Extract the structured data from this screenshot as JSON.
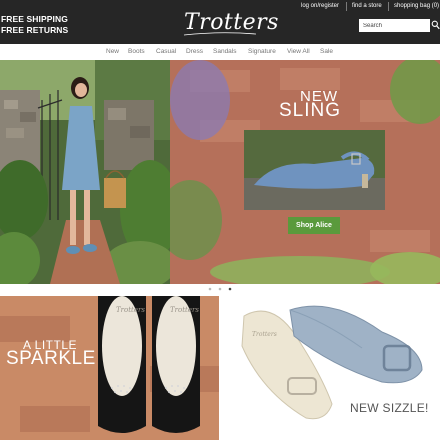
{
  "header": {
    "promo_line1": "FREE SHIPPING",
    "promo_line2": "FREE RETURNS",
    "logo": "Trotters",
    "util_links": [
      "log on/register",
      "find a store",
      "shopping bag (0)"
    ],
    "search_placeholder": "Search"
  },
  "nav": {
    "items": [
      "New",
      "Boots",
      "Casual",
      "Dress",
      "Sandals",
      "Signature",
      "View All",
      "Sale"
    ]
  },
  "hero": {
    "headline_new": "NEW",
    "headline_sling": "SLING",
    "button_label": "Shop Alice",
    "carousel": {
      "total": 3,
      "active": 3
    }
  },
  "promos": {
    "left_line1": "A LITTLE",
    "left_line2": "SPARKLE",
    "right_text": "NEW SIZZLE!"
  },
  "colors": {
    "header_bg": "#262626",
    "button_green": "#5a9a3c",
    "nav_text": "#777777"
  }
}
